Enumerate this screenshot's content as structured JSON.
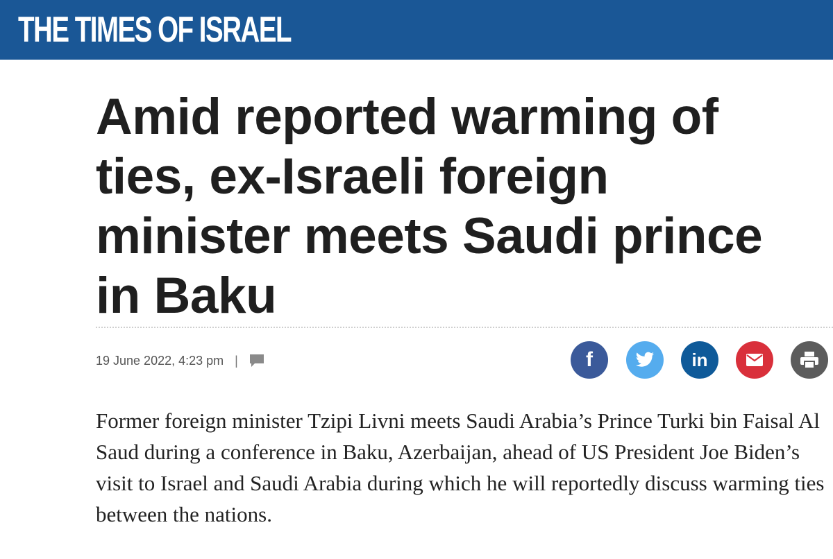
{
  "site": {
    "name": "THE TIMES OF ISRAEL",
    "brand_color": "#1a5796"
  },
  "article": {
    "headline": "Amid reported warming of ties, ex-Israeli foreign minister meets Saudi prince in Baku",
    "date": "19 June 2022, 4:23 pm",
    "separator": "|",
    "caption": "Former foreign minister Tzipi Livni meets Saudi Arabia’s Prince Turki bin Faisal Al Saud during a conference in Baku, Azerbaijan, ahead of US President Joe Biden’s visit to Israel and Saudi Arabia during which he will reportedly discuss warming ties between the nations."
  },
  "share": {
    "facebook": {
      "icon": "facebook-icon",
      "glyph": "f",
      "color": "#3b5a9a"
    },
    "twitter": {
      "icon": "twitter-icon",
      "color": "#55acee"
    },
    "linkedin": {
      "icon": "linkedin-icon",
      "glyph": "in",
      "color": "#0f5a99"
    },
    "email": {
      "icon": "mail-icon",
      "color": "#d9303b"
    },
    "print": {
      "icon": "printer-icon",
      "color": "#5c5c5c"
    }
  },
  "icons": {
    "comment": "comment-icon"
  }
}
